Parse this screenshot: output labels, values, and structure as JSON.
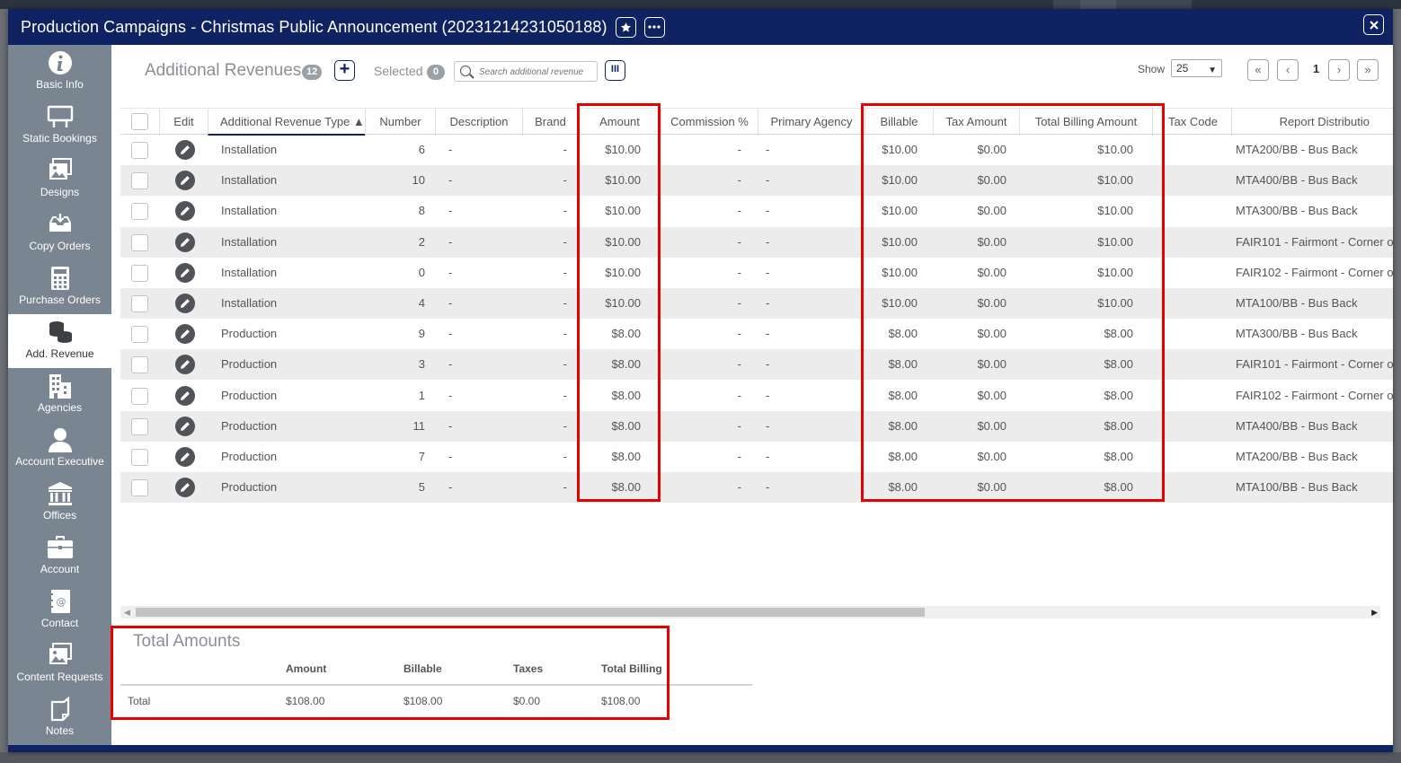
{
  "window": {
    "title": "Production Campaigns - Christmas Public Announcement (20231214231050188)",
    "star_icon": "star-icon",
    "more_icon": "more-icon",
    "close_icon": "close-icon"
  },
  "sidebar": {
    "items": [
      {
        "label": "Basic Info",
        "icon": "info-icon"
      },
      {
        "label": "Static Bookings",
        "icon": "billboard-icon"
      },
      {
        "label": "Designs",
        "icon": "image-icon"
      },
      {
        "label": "Copy Orders",
        "icon": "inbox-download-icon"
      },
      {
        "label": "Purchase Orders",
        "icon": "calculator-icon"
      },
      {
        "label": "Add. Revenue",
        "icon": "coins-icon",
        "active": true
      },
      {
        "label": "Agencies",
        "icon": "building-icon"
      },
      {
        "label": "Account Executive",
        "icon": "person-icon"
      },
      {
        "label": "Offices",
        "icon": "bank-icon"
      },
      {
        "label": "Account",
        "icon": "briefcase-icon"
      },
      {
        "label": "Contact",
        "icon": "address-book-icon"
      },
      {
        "label": "Content Requests",
        "icon": "image-icon"
      },
      {
        "label": "Notes",
        "icon": "note-icon"
      }
    ]
  },
  "toolbar": {
    "title": "Additional Revenues",
    "count": "12",
    "add_label": "+",
    "selected_label": "Selected",
    "selected_count": "0",
    "search_placeholder": "Search additional revenue",
    "columns_label": "III",
    "show_label": "Show",
    "page_size": "25",
    "page_number": "1",
    "first_label": "«",
    "prev_label": "‹",
    "next_label": "›",
    "last_label": "»"
  },
  "table": {
    "headers": {
      "edit": "Edit",
      "type": "Additional Revenue Type ▲",
      "number": "Number",
      "description": "Description",
      "brand": "Brand",
      "amount": "Amount",
      "commission": "Commission %",
      "agency": "Primary Agency",
      "billable": "Billable",
      "tax": "Tax Amount",
      "total": "Total Billing Amount",
      "taxcode": "Tax Code",
      "report": "Report Distributio"
    },
    "rows": [
      {
        "type": "Installation",
        "number": "6",
        "description": "-",
        "brand": "-",
        "amount": "$10.00",
        "commission": "-",
        "agency": "-",
        "billable": "$10.00",
        "tax": "$0.00",
        "total": "$10.00",
        "report": "MTA200/BB - Bus Back"
      },
      {
        "type": "Installation",
        "number": "10",
        "description": "-",
        "brand": "-",
        "amount": "$10.00",
        "commission": "-",
        "agency": "-",
        "billable": "$10.00",
        "tax": "$0.00",
        "total": "$10.00",
        "report": "MTA400/BB - Bus Back"
      },
      {
        "type": "Installation",
        "number": "8",
        "description": "-",
        "brand": "-",
        "amount": "$10.00",
        "commission": "-",
        "agency": "-",
        "billable": "$10.00",
        "tax": "$0.00",
        "total": "$10.00",
        "report": "MTA300/BB - Bus Back"
      },
      {
        "type": "Installation",
        "number": "2",
        "description": "-",
        "brand": "-",
        "amount": "$10.00",
        "commission": "-",
        "agency": "-",
        "billable": "$10.00",
        "tax": "$0.00",
        "total": "$10.00",
        "report": "FAIR101 - Fairmont - Corner o"
      },
      {
        "type": "Installation",
        "number": "0",
        "description": "-",
        "brand": "-",
        "amount": "$10.00",
        "commission": "-",
        "agency": "-",
        "billable": "$10.00",
        "tax": "$0.00",
        "total": "$10.00",
        "report": "FAIR102 - Fairmont - Corner o"
      },
      {
        "type": "Installation",
        "number": "4",
        "description": "-",
        "brand": "-",
        "amount": "$10.00",
        "commission": "-",
        "agency": "-",
        "billable": "$10.00",
        "tax": "$0.00",
        "total": "$10.00",
        "report": "MTA100/BB - Bus Back"
      },
      {
        "type": "Production",
        "number": "9",
        "description": "-",
        "brand": "-",
        "amount": "$8.00",
        "commission": "-",
        "agency": "-",
        "billable": "$8.00",
        "tax": "$0.00",
        "total": "$8.00",
        "report": "MTA300/BB - Bus Back"
      },
      {
        "type": "Production",
        "number": "3",
        "description": "-",
        "brand": "-",
        "amount": "$8.00",
        "commission": "-",
        "agency": "-",
        "billable": "$8.00",
        "tax": "$0.00",
        "total": "$8.00",
        "report": "FAIR101 - Fairmont - Corner o"
      },
      {
        "type": "Production",
        "number": "1",
        "description": "-",
        "brand": "-",
        "amount": "$8.00",
        "commission": "-",
        "agency": "-",
        "billable": "$8.00",
        "tax": "$0.00",
        "total": "$8.00",
        "report": "FAIR102 - Fairmont - Corner o"
      },
      {
        "type": "Production",
        "number": "11",
        "description": "-",
        "brand": "-",
        "amount": "$8.00",
        "commission": "-",
        "agency": "-",
        "billable": "$8.00",
        "tax": "$0.00",
        "total": "$8.00",
        "report": "MTA400/BB - Bus Back"
      },
      {
        "type": "Production",
        "number": "7",
        "description": "-",
        "brand": "-",
        "amount": "$8.00",
        "commission": "-",
        "agency": "-",
        "billable": "$8.00",
        "tax": "$0.00",
        "total": "$8.00",
        "report": "MTA200/BB - Bus Back"
      },
      {
        "type": "Production",
        "number": "5",
        "description": "-",
        "brand": "-",
        "amount": "$8.00",
        "commission": "-",
        "agency": "-",
        "billable": "$8.00",
        "tax": "$0.00",
        "total": "$8.00",
        "report": "MTA100/BB - Bus Back"
      }
    ]
  },
  "totals": {
    "title": "Total Amounts",
    "headers": {
      "amount": "Amount",
      "billable": "Billable",
      "taxes": "Taxes",
      "total": "Total Billing"
    },
    "row": {
      "label": "Total",
      "amount": "$108.00",
      "billable": "$108.00",
      "taxes": "$0.00",
      "total": "$108.00"
    }
  },
  "colors": {
    "title_bar": "#0f2261",
    "sidebar": "#7a8592",
    "highlight": "#e60000",
    "row_alt": "#ececec"
  }
}
